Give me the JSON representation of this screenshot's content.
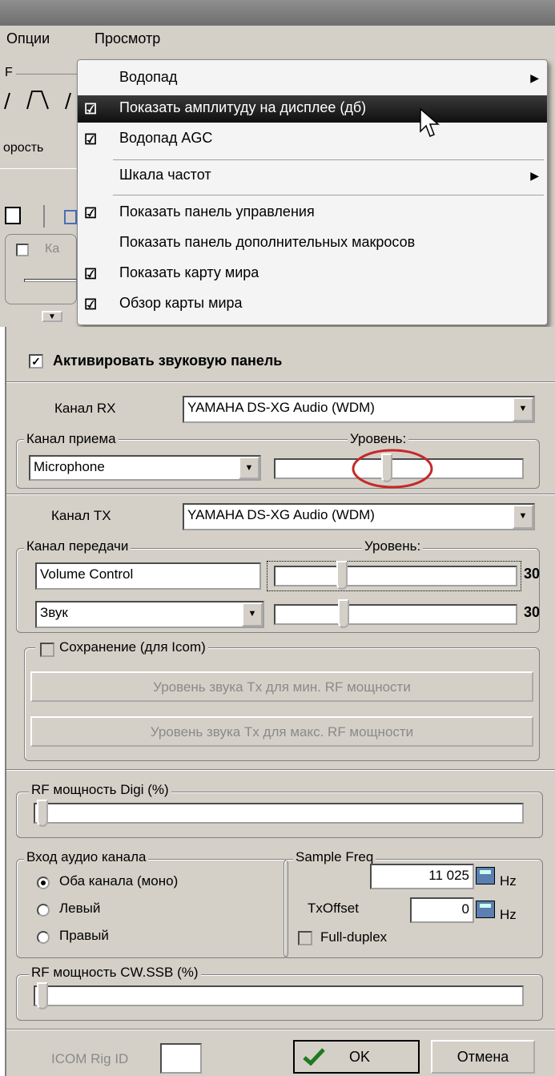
{
  "menubar": {
    "options": "Опции",
    "view": "Просмотр"
  },
  "background": {
    "f_label": "F",
    "speed_label": "орость",
    "channel_label": "Ка"
  },
  "view_menu": {
    "items": [
      {
        "label": "Водопад",
        "checked": false,
        "submenu": true
      },
      {
        "label": "Показать амплитуду на дисплее (дб)",
        "checked": true,
        "submenu": false,
        "highlighted": true
      },
      {
        "label": "Водопад AGC",
        "checked": true,
        "submenu": false
      },
      {
        "label": "Шкала частот",
        "checked": false,
        "submenu": true
      },
      {
        "label": "Показать панель управления",
        "checked": true,
        "submenu": false
      },
      {
        "label": "Показать панель дополнительных макросов",
        "checked": false,
        "submenu": false
      },
      {
        "label": "Показать карту мира",
        "checked": true,
        "submenu": false
      },
      {
        "label": "Обзор карты мира",
        "checked": true,
        "submenu": false
      }
    ]
  },
  "dialog": {
    "activate_label": "Активировать звуковую панель",
    "rx_label": "Канал RX",
    "rx_device": "YAMAHA DS-XG Audio (WDM)",
    "rx_channel_legend": "Канал приема",
    "rx_level_legend": "Уровень:",
    "rx_source": "Microphone",
    "rx_level": 0.48,
    "tx_label": "Канал TX",
    "tx_device": "YAMAHA DS-XG Audio (WDM)",
    "tx_channel_legend": "Канал передачи",
    "tx_level_legend": "Уровень:",
    "tx_source_1": "Volume Control",
    "tx_value_1": "30",
    "tx_source_2": "Звук",
    "tx_value_2": "30",
    "save_icom_label": "Сохранение (для Icom)",
    "tx_min_button": "Уровень звука Tx для мин. RF мощности",
    "tx_max_button": "Уровень звука Tx для макс. RF мощности",
    "rf_digi_legend": "RF мощность Digi (%)",
    "audio_input_legend": "Вход аудио канала",
    "radio_both": "Оба канала (моно)",
    "radio_left": "Левый",
    "radio_right": "Правый",
    "sample_freq_legend": "Sample Freq",
    "sample_freq_value": "11 025",
    "hz1": "Hz",
    "txoffset_label": "TxOffset",
    "txoffset_value": "0",
    "hz2": "Hz",
    "full_duplex": "Full-duplex",
    "rf_cw_legend": "RF мощность CW.SSB (%)",
    "icom_label": "ICOM Rig ID",
    "ok_label": "OK",
    "cancel_label": "Отмена"
  },
  "colors": {
    "highlight_circle": "#c62828",
    "ok_check": "#1e7a1e"
  }
}
